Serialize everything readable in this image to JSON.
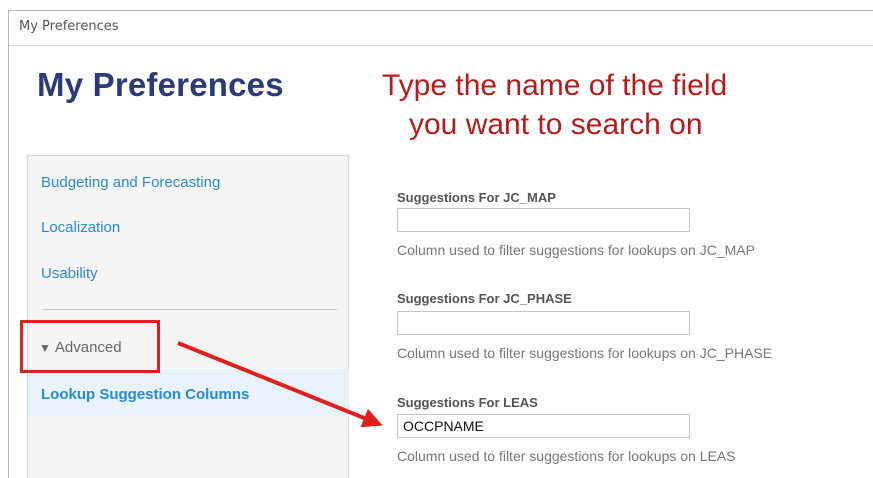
{
  "window": {
    "title": "My Preferences"
  },
  "page": {
    "title": "My Preferences"
  },
  "instruction": {
    "line1": "Type the name of the field",
    "line2": "you want to search on"
  },
  "sidebar": {
    "items": [
      {
        "label": "Budgeting and Forecasting"
      },
      {
        "label": "Localization"
      },
      {
        "label": "Usability"
      }
    ],
    "advanced": {
      "caret": "▼",
      "label": "Advanced"
    },
    "selected": {
      "label": "Lookup Suggestion Columns"
    }
  },
  "fields": [
    {
      "label": "Suggestions For JC_MAP",
      "value": "",
      "help": "Column used to filter suggestions for lookups on JC_MAP"
    },
    {
      "label": "Suggestions For JC_PHASE",
      "value": "",
      "help": "Column used to filter suggestions for lookups on JC_PHASE"
    },
    {
      "label": "Suggestions For LEAS",
      "value": "OCCPNAME",
      "help": "Column used to filter suggestions for lookups on LEAS"
    }
  ],
  "colors": {
    "annotation": "#e0201e",
    "instruction": "#b51b1b",
    "title": "#2a3b78",
    "link": "#2a8bd4"
  }
}
